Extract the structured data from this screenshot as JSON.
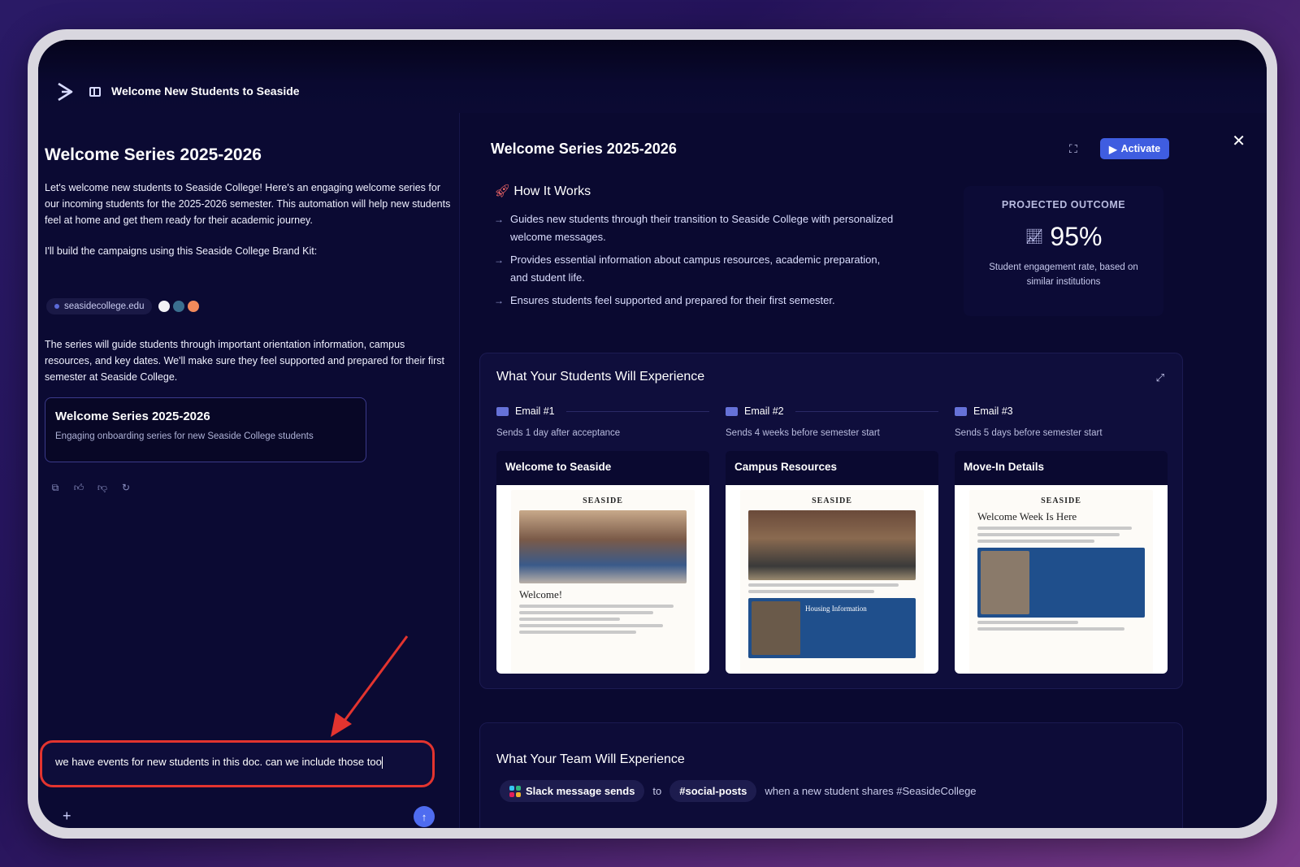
{
  "header": {
    "title": "Welcome New Students to Seaside"
  },
  "chat": {
    "heading": "Welcome Series 2025-2026",
    "intro": "Let's welcome new students to Seaside College! Here's an engaging welcome series for our incoming students for the 2025-2026 semester. This automation will help new students feel at home and get them ready for their academic journey.",
    "brandkit_text": "I'll build the campaigns using this Seaside College Brand Kit:",
    "brand_domain": "seasidecollege.edu",
    "brand_colors": [
      "#f2f2f6",
      "#3a6f8f",
      "#f28a5b"
    ],
    "summary": "The series will guide students through important orientation information, campus resources, and key dates. We'll make sure they feel supported and prepared for their first semester at Seaside College.",
    "card": {
      "title": "Welcome Series 2025-2026",
      "subtitle": "Engaging onboarding series for new Seaside College students"
    },
    "composer_value": "we have events for new students in this doc. can we include those too"
  },
  "panel": {
    "title": "Welcome Series 2025-2026",
    "activate_label": "Activate",
    "close_label": "✕",
    "how_title": "How It Works",
    "how_items": [
      "Guides new students through their transition to Seaside College with personalized welcome messages.",
      "Provides essential information about campus resources, academic preparation, and student life.",
      "Ensures students feel supported and prepared for their first semester."
    ],
    "outcome": {
      "label": "PROJECTED OUTCOME",
      "value": "95%",
      "description": "Student engagement rate, based on similar institutions"
    },
    "students": {
      "title": "What Your Students Will Experience",
      "emails": [
        {
          "label": "Email #1",
          "schedule": "Sends 1 day after acceptance",
          "preview_title": "Welcome to Seaside",
          "mock_heading": "Welcome!"
        },
        {
          "label": "Email #2",
          "schedule": "Sends 4 weeks before semester start",
          "preview_title": "Campus Resources",
          "mock_heading": "Housing Information"
        },
        {
          "label": "Email #3",
          "schedule": "Sends 5 days before semester start",
          "preview_title": "Move-In Details",
          "mock_heading": "Welcome Week Is Here"
        }
      ],
      "mock_brand": "SEASIDE"
    },
    "team": {
      "title": "What Your Team Will Experience",
      "action_pill": "Slack message sends",
      "to_label": "to",
      "channel_pill": "#social-posts",
      "condition": "when a new student shares #SeasideCollege"
    }
  }
}
